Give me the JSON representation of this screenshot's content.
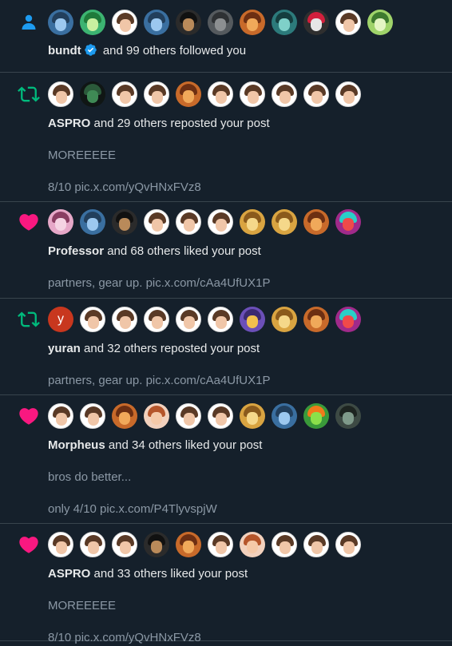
{
  "colors": {
    "background": "#15202b",
    "divider": "#38444d",
    "text": "#e7e9ea",
    "muted": "#8b98a5",
    "follow": "#1d9bf0",
    "repost": "#00ba7c",
    "like": "#f91880"
  },
  "notifications": [
    {
      "kind": "follow",
      "icon": "person-icon",
      "user": "bundt",
      "verified": true,
      "rest": " and 99 others followed you",
      "lines": []
    },
    {
      "kind": "repost",
      "icon": "repost-icon",
      "user": "ASPRO",
      "verified": false,
      "rest": " and 29 others reposted your post",
      "lines": [
        "MOREEEEE",
        "8/10 pic.x.com/yQvHNxFVz8"
      ]
    },
    {
      "kind": "like",
      "icon": "heart-icon",
      "user": "Professor",
      "verified": false,
      "rest": " and 68 others liked your post",
      "lines": [
        "partners, gear up. pic.x.com/cAa4UfUX1P"
      ]
    },
    {
      "kind": "repost",
      "icon": "repost-icon",
      "user": "yuran",
      "verified": false,
      "rest": " and 32 others reposted your post",
      "lines": [
        "partners, gear up. pic.x.com/cAa4UfUX1P"
      ],
      "letter_avatar": "y"
    },
    {
      "kind": "like",
      "icon": "heart-icon",
      "user": "Morpheus",
      "verified": false,
      "rest": " and 34 others liked your post",
      "lines": [
        "bros do better...",
        "only 4/10 pic.x.com/P4TlyvspjW"
      ]
    },
    {
      "kind": "like",
      "icon": "heart-icon",
      "user": "ASPRO",
      "verified": false,
      "rest": " and 33 others liked your post",
      "lines": [
        "MOREEEEE",
        "8/10 pic.x.com/yQvHNxFVz8"
      ]
    }
  ]
}
